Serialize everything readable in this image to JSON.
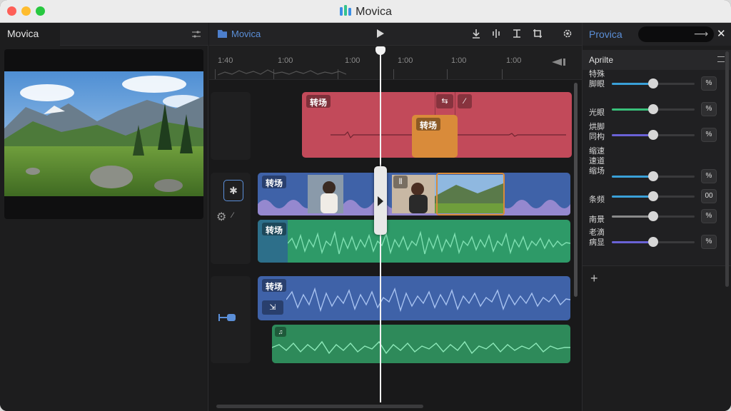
{
  "window": {
    "title": "Movica"
  },
  "left_panel": {
    "tab": "Movica"
  },
  "timeline": {
    "title": "Movica",
    "ruler": [
      "1:40",
      "1:00",
      "1:00",
      "1:00",
      "1:00",
      "1:00"
    ],
    "clip_label": "转场"
  },
  "right_panel": {
    "title": "Provica",
    "search_value": "",
    "section_title": "Aprilte",
    "params": [
      {
        "labels": [
          "特殊",
          "脚眼"
        ],
        "unit": "%",
        "value": 0.5,
        "color": "#3aa0d8"
      },
      {
        "labels": [
          "光眼"
        ],
        "unit": "%",
        "value": 0.5,
        "color": "#39c07a"
      },
      {
        "labels": [
          "烘脚",
          "同构"
        ],
        "unit": "%",
        "value": 0.5,
        "color": "#6a62d6"
      },
      {
        "labels": [
          "缩速",
          "速道",
          "缩场"
        ],
        "unit": "%",
        "value": 0.5,
        "color": "#3aa0d8"
      },
      {
        "labels": [
          "条频"
        ],
        "unit": "00",
        "value": 0.5,
        "color": "#3aa0d8"
      },
      {
        "labels": [
          "南景"
        ],
        "unit": "%",
        "value": 0.5,
        "color": "#8a8a8a"
      },
      {
        "labels": [
          "老滴",
          "病显"
        ],
        "unit": "%",
        "value": 0.5,
        "color": "#6a62d6"
      }
    ]
  },
  "colors": {
    "accent": "#5b8fd8",
    "audio_red": "#c24a5a",
    "video_blue": "#3f62a8",
    "audio_green": "#2e9a68",
    "clip_orange": "#d98b3a"
  }
}
